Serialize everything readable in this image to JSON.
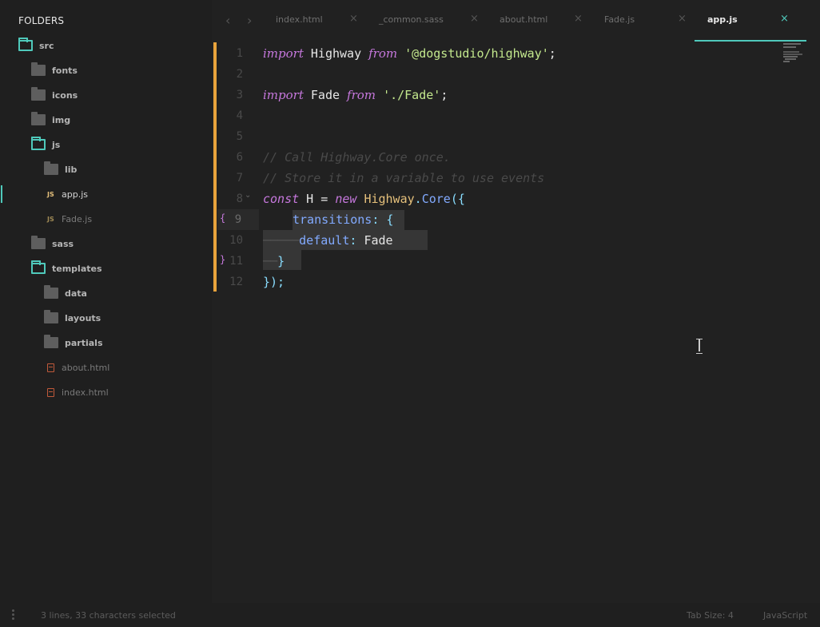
{
  "sidebar": {
    "title": "FOLDERS",
    "items": [
      {
        "label": "src",
        "type": "folder-open"
      },
      {
        "label": "fonts",
        "type": "folder"
      },
      {
        "label": "icons",
        "type": "folder"
      },
      {
        "label": "img",
        "type": "folder"
      },
      {
        "label": "js",
        "type": "folder-open"
      },
      {
        "label": "lib",
        "type": "folder"
      },
      {
        "label": "app.js",
        "type": "file-js",
        "active": true
      },
      {
        "label": "Fade.js",
        "type": "file-js"
      },
      {
        "label": "sass",
        "type": "folder"
      },
      {
        "label": "templates",
        "type": "folder-open"
      },
      {
        "label": "data",
        "type": "folder"
      },
      {
        "label": "layouts",
        "type": "folder"
      },
      {
        "label": "partials",
        "type": "folder"
      },
      {
        "label": "about.html",
        "type": "file-html"
      },
      {
        "label": "index.html",
        "type": "file-html"
      }
    ],
    "js_badge": "JS"
  },
  "tabs": [
    {
      "label": "index.html"
    },
    {
      "label": "_common.sass"
    },
    {
      "label": "about.html"
    },
    {
      "label": "Fade.js"
    },
    {
      "label": "app.js",
      "active": true
    }
  ],
  "tab_close_glyph": "×",
  "nav": {
    "back": "‹",
    "forward": "›"
  },
  "editor": {
    "line_numbers": [
      "1",
      "2",
      "3",
      "4",
      "5",
      "6",
      "7",
      "8",
      "9",
      "10",
      "11",
      "12"
    ],
    "fold_open": "{",
    "fold_close": "}",
    "lines": {
      "l1": {
        "kw1": "import",
        "name": " Highway ",
        "kw2": "from",
        "sp": " ",
        "str": "'@dogstudio/highway'",
        "end": ";"
      },
      "l3": {
        "kw1": "import",
        "name": " Fade ",
        "kw2": "from",
        "sp": " ",
        "str": "'./Fade'",
        "end": ";"
      },
      "l6": "// Call Highway.Core once.",
      "l7": "// Store it in a variable to use events",
      "l8": {
        "kw1": "const",
        "name": " H = ",
        "kw2": "new",
        "sp": " ",
        "cls": "Highway",
        "dot": ".",
        "prop": "Core",
        "punc": "({"
      },
      "l9": {
        "prop": "transitions",
        "punc": ": {"
      },
      "l10": {
        "prop": "default",
        "punc": ": ",
        "val": "Fade"
      },
      "l11": "}",
      "l12": "});"
    }
  },
  "status": {
    "selection": "3 lines, 33 characters selected",
    "tab_size": "Tab Size: 4",
    "syntax": "JavaScript"
  },
  "colors": {
    "accent": "#4fc9bb",
    "modified": "#e8a33c",
    "keyword": "#c678dd",
    "string": "#c3e88d",
    "class": "#e5c07b",
    "property": "#82aaff"
  }
}
